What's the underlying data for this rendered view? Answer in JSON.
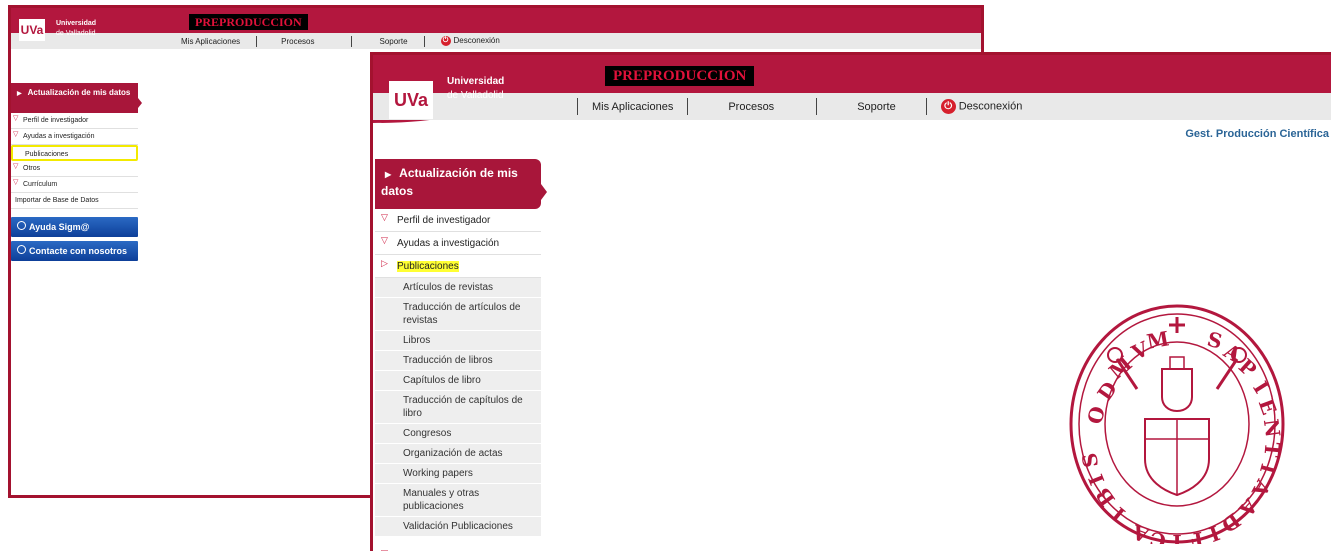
{
  "logo": {
    "abbr": "UVa",
    "line1": "Universidad",
    "line2": "de Valladolid"
  },
  "env_label": "PREPRODUCCION",
  "nav": {
    "mis_aplicaciones": "Mis Aplicaciones",
    "procesos": "Procesos",
    "soporte": "Soporte",
    "desconexion": "Desconexión"
  },
  "gest_link": "Gest. Producción Científica",
  "sidebar": {
    "header": "Actualización de mis datos",
    "items": [
      "Perfil de investigador",
      "Ayudas a investigación",
      "Publicaciones",
      "Otros",
      "Currículum",
      "Importar de Base de Datos"
    ],
    "help_button": "Ayuda Sigm@",
    "contact_button": "Contacte con nosotros"
  },
  "publicaciones_sub": [
    "Artículos de revistas",
    "Traducción de artículos de revistas",
    "Libros",
    "Traducción de libros",
    "Capítulos de libro",
    "Traducción de capítulos de libro",
    "Congresos",
    "Organización de actas",
    "Working papers",
    "Manuales y otras publicaciones",
    "Validación Publicaciones"
  ],
  "seal_text": "DOMVM + SAPIENTIA ADIFICAVIT SIBI",
  "colors": {
    "brand": "#b3173e",
    "nav_bg": "#e9e9e9",
    "highlight": "#ffff33",
    "link": "#2a6496",
    "button": "#0d3f99"
  }
}
